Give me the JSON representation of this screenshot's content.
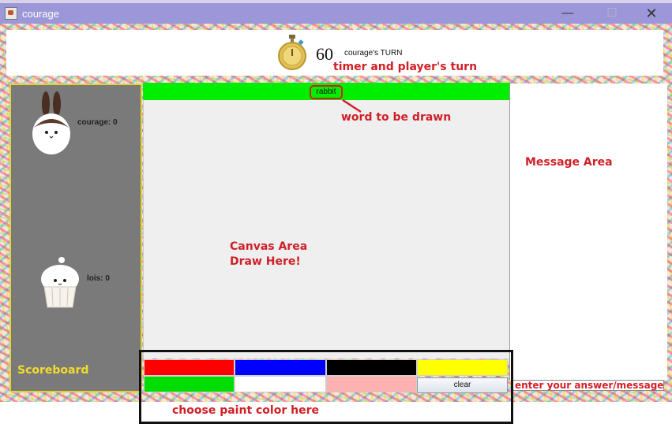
{
  "window": {
    "title": "courage",
    "minimize": "—",
    "maximize": "☐",
    "close": "✕"
  },
  "timer": {
    "count": "60",
    "turn": "courage's TURN"
  },
  "word": {
    "text": "rabbit"
  },
  "players": [
    {
      "label": "courage:  0"
    },
    {
      "label": "lois:  0"
    }
  ],
  "palette": {
    "colors": [
      "#ff0000",
      "#0000ff",
      "#000000",
      "#ffff00",
      "#00dd00",
      "#ffffff",
      "#ffb0b0"
    ],
    "clear_label": "clear"
  },
  "annotations": {
    "timer": "timer and player's turn",
    "word": "word to  be drawn",
    "message": "Message Area",
    "canvas_line1": "Canvas Area",
    "canvas_line2": "Draw Here!",
    "scoreboard": "Scoreboard",
    "answer": "enter your answer/message",
    "palette": "choose paint color here"
  },
  "icons": {
    "stopwatch": "stopwatch-icon",
    "app": "java-app-icon"
  }
}
